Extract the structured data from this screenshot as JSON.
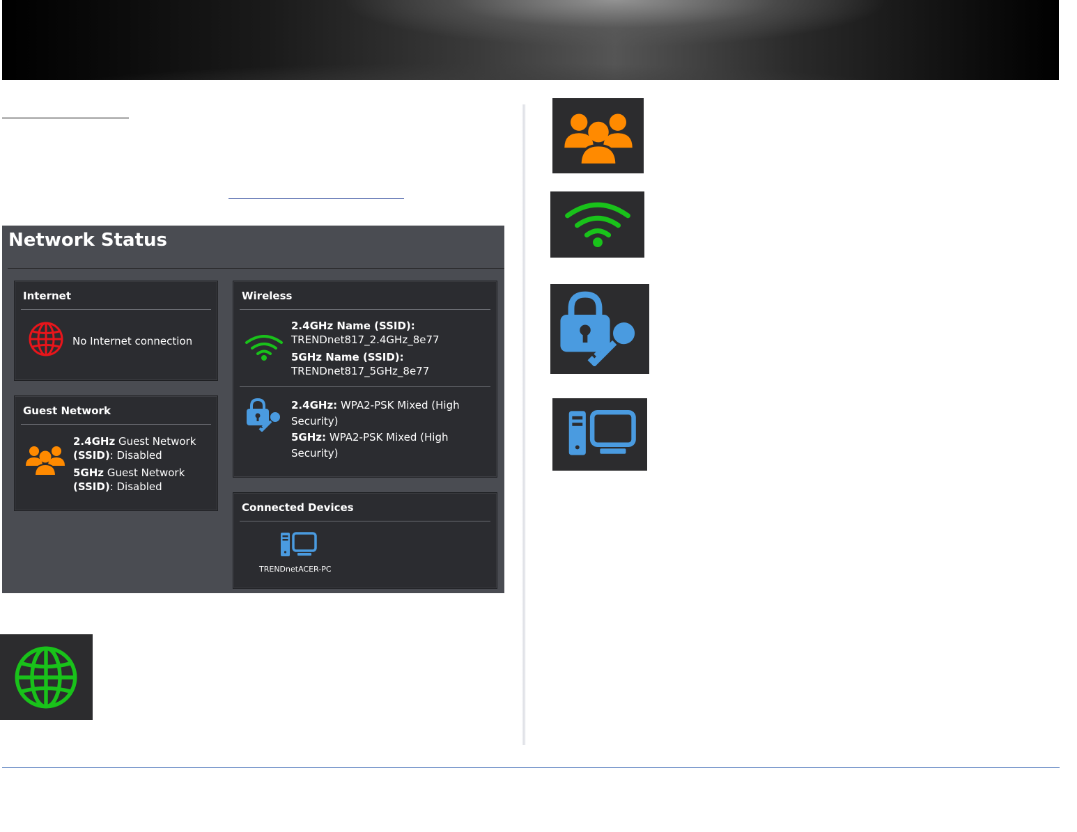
{
  "network_status": {
    "title": "Network Status",
    "internet": {
      "heading": "Internet",
      "status": "No Internet connection"
    },
    "guest": {
      "heading": "Guest Network",
      "g24_band": "2.4GHz",
      "g24_mid": " Guest Network",
      "g24_ssid": "(SSID)",
      "g24_status": ": Disabled",
      "g5_band": "5GHz",
      "g5_mid": " Guest Network",
      "g5_ssid": "(SSID)",
      "g5_status": ": Disabled"
    },
    "wireless": {
      "heading": "Wireless",
      "ssid24_label": "2.4GHz Name (SSID):",
      "ssid24_value": "TRENDnet817_2.4GHz_8e77",
      "ssid5_label": "5GHz Name (SSID):",
      "ssid5_value": "TRENDnet817_5GHz_8e77",
      "sec24_label": "2.4GHz:",
      "sec24_value1": " WPA2-PSK Mixed (High",
      "sec24_value2": "Security)",
      "sec5_label": "5GHz:",
      "sec5_value1": " WPA2-PSK Mixed (High",
      "sec5_value2": "Security)"
    },
    "devices": {
      "heading": "Connected Devices",
      "device_name": "TRENDnetACER-PC"
    }
  },
  "colors": {
    "internet_icon": "#e8151b",
    "guest_icon": "#ff8a00",
    "wifi_icon": "#19c21a",
    "security_icon": "#4a9be0",
    "device_icon": "#4a9be0",
    "globe_green": "#19c21a"
  },
  "icons": [
    "globe-icon",
    "guest-users-icon",
    "wifi-icon",
    "lock-key-icon",
    "computer-icon"
  ]
}
